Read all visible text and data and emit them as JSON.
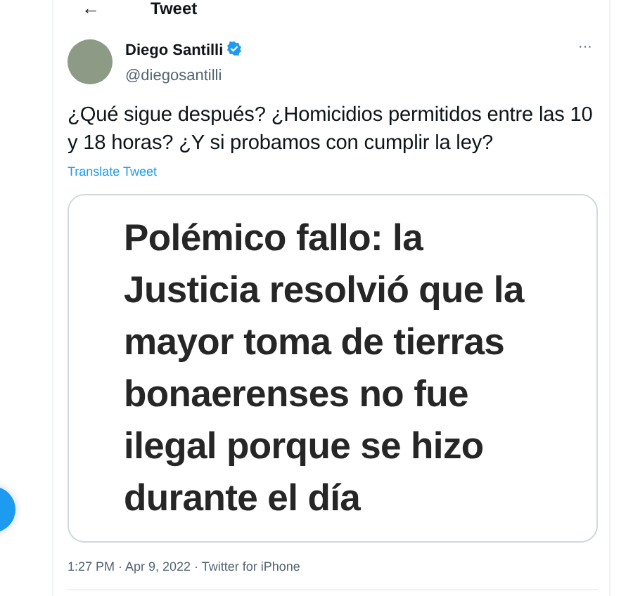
{
  "header": {
    "back_icon": "←",
    "title": "Tweet"
  },
  "tweet": {
    "author": {
      "name": "Diego Santilli",
      "verified": true,
      "handle": "@diegosantilli"
    },
    "more": "···",
    "text": "¿Qué sigue después? ¿Homicidios permitidos entre las 10 y 18 horas? ¿Y si probamos con cumplir la ley?",
    "translate": "Translate Tweet",
    "media": {
      "kind": "text-image",
      "lines": [
        "Polémico fallo: la",
        "Justicia resolvió que la",
        "mayor toma de tierras",
        "bonaerenses no fue",
        "ilegal porque se hizo",
        "durante el día"
      ]
    },
    "meta": "1:27 PM · Apr 9, 2022 · Twitter for iPhone"
  }
}
